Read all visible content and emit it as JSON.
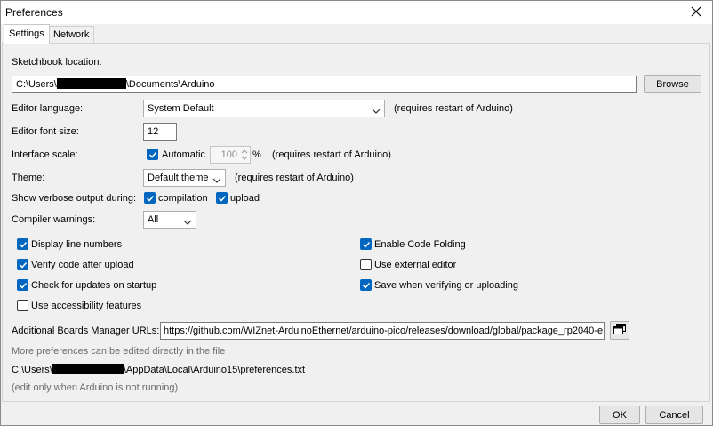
{
  "window": {
    "title": "Preferences"
  },
  "tabs": [
    {
      "label": "Settings",
      "active": true
    },
    {
      "label": "Network",
      "active": false
    }
  ],
  "sketchbook": {
    "label": "Sketchbook location:",
    "path_prefix": "C:\\Users\\",
    "path_suffix": "\\Documents\\Arduino",
    "browse": "Browse"
  },
  "editor_language": {
    "label": "Editor language:",
    "value": "System Default",
    "note": "(requires restart of Arduino)"
  },
  "font_size": {
    "label": "Editor font size:",
    "value": "12"
  },
  "interface_scale": {
    "label": "Interface scale:",
    "automatic_label": "Automatic",
    "automatic_checked": true,
    "value": "100",
    "unit": "%",
    "note": "(requires restart of Arduino)"
  },
  "theme": {
    "label": "Theme:",
    "value": "Default theme",
    "note": "(requires restart of Arduino)"
  },
  "verbose": {
    "label": "Show verbose output during:",
    "compilation": "compilation",
    "upload": "upload",
    "compilation_checked": true,
    "upload_checked": true
  },
  "compiler_warnings": {
    "label": "Compiler warnings:",
    "value": "All"
  },
  "options_left": [
    {
      "label": "Display line numbers",
      "checked": true
    },
    {
      "label": "Verify code after upload",
      "checked": true
    },
    {
      "label": "Check for updates on startup",
      "checked": true
    },
    {
      "label": "Use accessibility features",
      "checked": false
    }
  ],
  "options_right": [
    {
      "label": "Enable Code Folding",
      "checked": true
    },
    {
      "label": "Use external editor",
      "checked": false
    },
    {
      "label": "Save when verifying or uploading",
      "checked": true
    }
  ],
  "boards_urls": {
    "label": "Additional Boards Manager URLs:",
    "value": "https://github.com/WIZnet-ArduinoEthernet/arduino-pico/releases/download/global/package_rp2040-e"
  },
  "more_prefs": {
    "hint": "More preferences can be edited directly in the file",
    "path_prefix": "C:\\Users\\",
    "path_suffix": "\\AppData\\Local\\Arduino15\\preferences.txt",
    "edit_note": "(edit only when Arduino is not running)"
  },
  "buttons": {
    "ok": "OK",
    "cancel": "Cancel"
  },
  "colors": {
    "accent": "#0067c0",
    "window_bg": "#f0f0f0",
    "hint_gray": "#6d6d6d"
  },
  "icons": {
    "close": "close-icon",
    "chevron": "chevron-down-icon",
    "check": "checkmark-icon",
    "copy": "copy-window-icon"
  }
}
